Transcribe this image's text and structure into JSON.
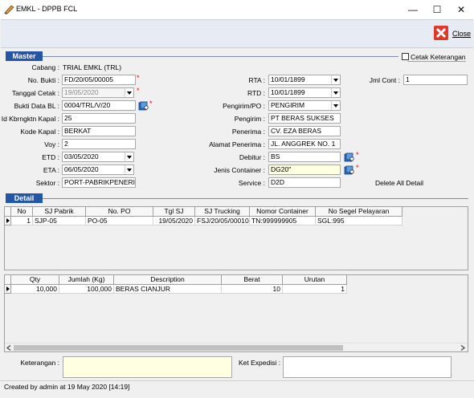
{
  "window": {
    "title": "EMKL - DPPB FCL",
    "minimize": "—",
    "maximize": "☐",
    "close": "✕"
  },
  "toolbar": {
    "close_label": "Close"
  },
  "master": {
    "header": "Master",
    "cetak_keterangan": "Cetak Keterangan",
    "cabang_label": "Cabang :",
    "cabang_value": "TRIAL EMKL (TRL)",
    "no_bukti_label": "No. Bukti :",
    "no_bukti_value": "FD/20/05/00005",
    "tanggal_cetak_label": "Tanggal Cetak :",
    "tanggal_cetak_value": "19/05/2020",
    "bukti_data_bl_label": "Bukti Data BL :",
    "bukti_data_bl_value": "0004/TRL/V/20",
    "id_kapal_label": "Id Kbrngktn Kapal :",
    "id_kapal_value": "25",
    "kode_kapal_label": "Kode Kapal :",
    "kode_kapal_value": "BERKAT",
    "voy_label": "Voy :",
    "voy_value": "2",
    "etd_label": "ETD :",
    "etd_value": "03/05/2020",
    "eta_label": "ETA :",
    "eta_value": "06/05/2020",
    "sektor_label": "Sektor :",
    "sektor_value": "PORT-PABRIKPENERIMA",
    "rta_label": "RTA :",
    "rta_value": "10/01/1899",
    "rtd_label": "RTD :",
    "rtd_value": "10/01/1899",
    "pengirim_po_label": "Pengirim/PO :",
    "pengirim_po_value": "PENGIRIM",
    "pengirim_label": "Pengirim :",
    "pengirim_value": "PT BERAS SUKSES",
    "penerima_label": "Penerima :",
    "penerima_value": "CV. EZA BERAS",
    "alamat_label": "Alamat Penerima :",
    "alamat_value": "JL. ANGGREK NO. 1",
    "debitur_label": "Debitur :",
    "debitur_value": "BS",
    "jenis_container_label": "Jenis Container :",
    "jenis_container_value": "DG20\"",
    "service_label": "Service :",
    "service_value": "D2D",
    "jml_cont_label": "Jml Cont :",
    "jml_cont_value": "1",
    "delete_all_label": "Delete All Detail"
  },
  "detail": {
    "header": "Detail",
    "grid1": {
      "columns": [
        "No",
        "SJ Pabrik",
        "No. PO",
        "Tgl SJ",
        "SJ Trucking",
        "Nomor Container",
        "No Segel Pelayaran"
      ],
      "row": [
        "1",
        "SJP-05",
        "PO-05",
        "19/05/2020",
        "FSJ/20/05/00010",
        "TN:999999905",
        "SGL:995"
      ]
    },
    "grid2": {
      "columns": [
        "Qty",
        "Jumlah (Kg)",
        "Description",
        "Berat",
        "Urutan"
      ],
      "row": [
        "10,000",
        "100,000",
        "BERAS CIANJUR",
        "10",
        "1"
      ]
    }
  },
  "footer": {
    "keterangan_label": "Keterangan :",
    "ket_expedisi_label": "Ket Expedisi :"
  },
  "status": {
    "text": "Created by admin at 19 May 2020 [14:19]"
  },
  "colors": {
    "section_header": "#2455a7",
    "required_mark": "#e00000",
    "close_icon": "#e0392a",
    "highlight_field": "#ffffe1"
  }
}
